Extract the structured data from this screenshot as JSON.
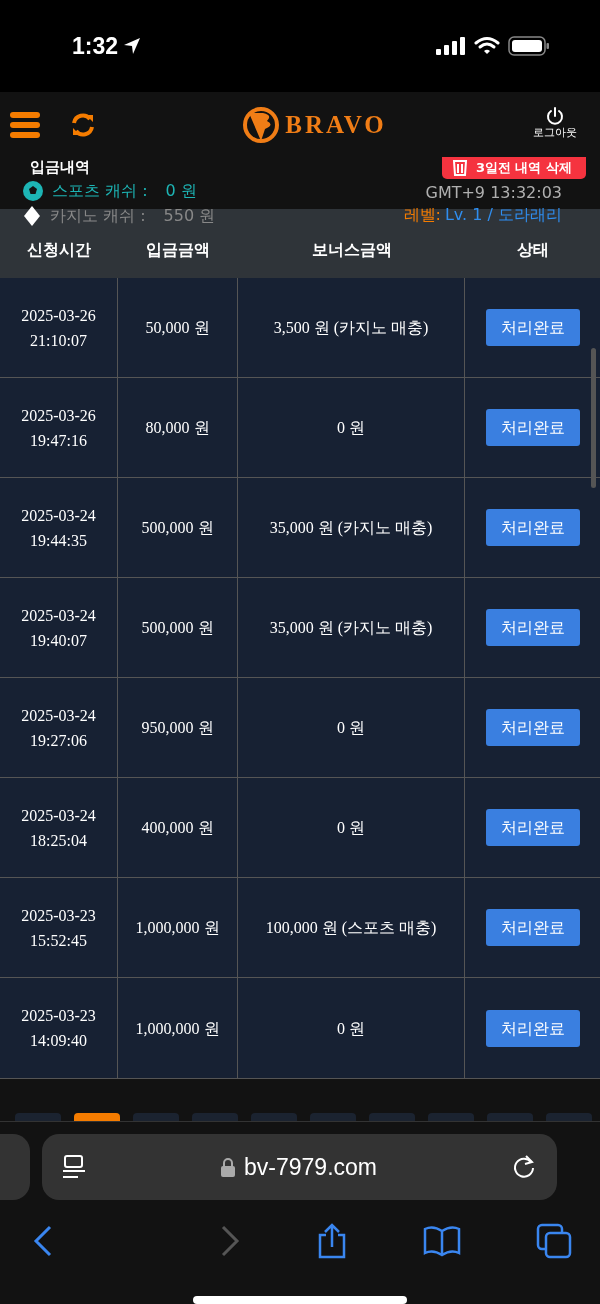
{
  "status_bar": {
    "time": "1:32"
  },
  "header": {
    "brand": "BRAVO",
    "logout": "로그아웃"
  },
  "info": {
    "title": "입금내역",
    "delete_button": "3일전 내역 삭제",
    "sports_cash_label": "스포츠 캐쉬 :",
    "sports_cash_value": "0 원",
    "casino_cash_label": "카지노 캐쉬 :",
    "casino_cash_value": "550 원",
    "clock": "GMT+9 13:32:03",
    "level_label": "레벨:",
    "level_value": "Lv. 1 / 도라래리"
  },
  "table": {
    "columns": [
      "신청시간",
      "입금금액",
      "보너스금액",
      "상태"
    ],
    "rows": [
      {
        "date": "2025-03-26",
        "time": "21:10:07",
        "amount": "50,000 원",
        "bonus": "3,500 원 (카지노 매충)",
        "status": "처리완료"
      },
      {
        "date": "2025-03-26",
        "time": "19:47:16",
        "amount": "80,000 원",
        "bonus": "0 원",
        "status": "처리완료"
      },
      {
        "date": "2025-03-24",
        "time": "19:44:35",
        "amount": "500,000 원",
        "bonus": "35,000 원 (카지노 매충)",
        "status": "처리완료"
      },
      {
        "date": "2025-03-24",
        "time": "19:40:07",
        "amount": "500,000 원",
        "bonus": "35,000 원 (카지노 매충)",
        "status": "처리완료"
      },
      {
        "date": "2025-03-24",
        "time": "19:27:06",
        "amount": "950,000 원",
        "bonus": "0 원",
        "status": "처리완료"
      },
      {
        "date": "2025-03-24",
        "time": "18:25:04",
        "amount": "400,000 원",
        "bonus": "0 원",
        "status": "처리완료"
      },
      {
        "date": "2025-03-23",
        "time": "15:52:45",
        "amount": "1,000,000 원",
        "bonus": "100,000 원 (스포츠 매충)",
        "status": "처리완료"
      },
      {
        "date": "2025-03-23",
        "time": "14:09:40",
        "amount": "1,000,000 원",
        "bonus": "0 원",
        "status": "처리완료"
      }
    ]
  },
  "pages": [
    {
      "selected": false
    },
    {
      "selected": true
    },
    {
      "selected": false
    },
    {
      "selected": false
    },
    {
      "selected": false
    },
    {
      "selected": false
    },
    {
      "selected": false
    },
    {
      "selected": false
    },
    {
      "selected": false
    },
    {
      "selected": false
    }
  ],
  "browser": {
    "url": "bv-7979.com"
  }
}
